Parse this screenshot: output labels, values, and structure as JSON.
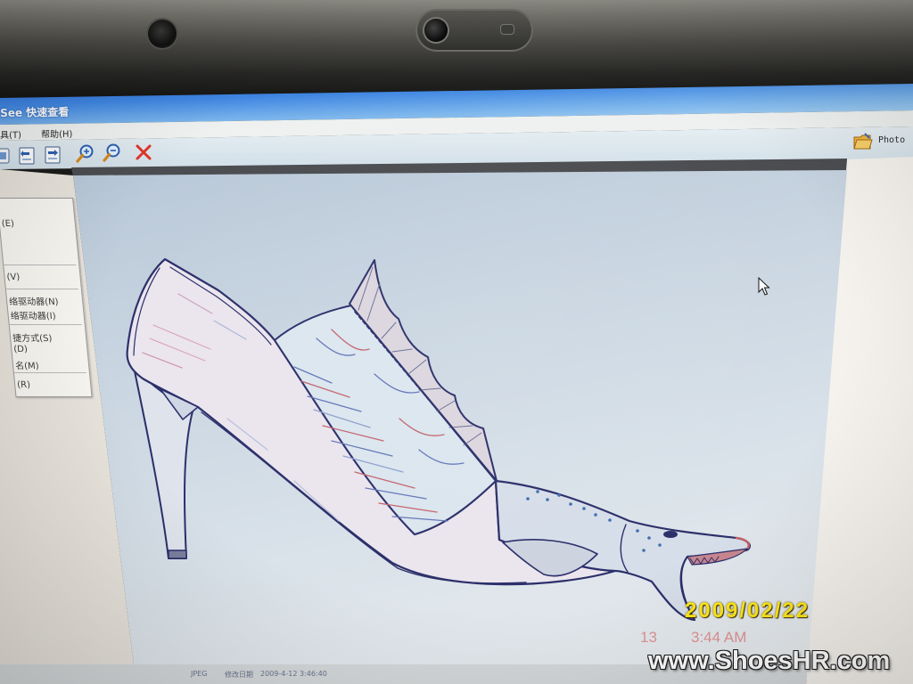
{
  "window": {
    "title": "See 快速查看"
  },
  "menu_bar": {
    "items": [
      {
        "label": "具(T)"
      },
      {
        "label": "帮助(H)"
      }
    ]
  },
  "toolbar": {
    "buttons": [
      {
        "icon": "toolbar-partial-icon"
      },
      {
        "icon": "prev-image-icon"
      },
      {
        "icon": "next-image-icon"
      },
      {
        "icon": "zoom-in-icon"
      },
      {
        "icon": "zoom-out-icon"
      },
      {
        "icon": "close-icon"
      }
    ],
    "photo_button": {
      "label": "Photo",
      "icon": "photo-folder-icon"
    }
  },
  "context_menu": {
    "items": [
      "(E)",
      "(V)",
      "络驱动器(N)",
      "络驱动器(I)",
      "捷方式(S)",
      "(D)",
      "名(M)",
      "(R)"
    ]
  },
  "status_bar": {
    "segments": [
      "JPEG",
      "修改日期",
      "2009-4-12 3:46:40"
    ]
  },
  "photo_overlay": {
    "date_stamp": "2009/02/22",
    "number": "13",
    "time": "3:44 AM",
    "watermark": "www.ShoesHR.com"
  },
  "colors": {
    "title_bar": "#3f86e2",
    "sketch_ink": "#2b2f6a",
    "close_icon": "#e0342a",
    "date_stamp": "#ffe81a",
    "watermark": "#ffffff"
  }
}
